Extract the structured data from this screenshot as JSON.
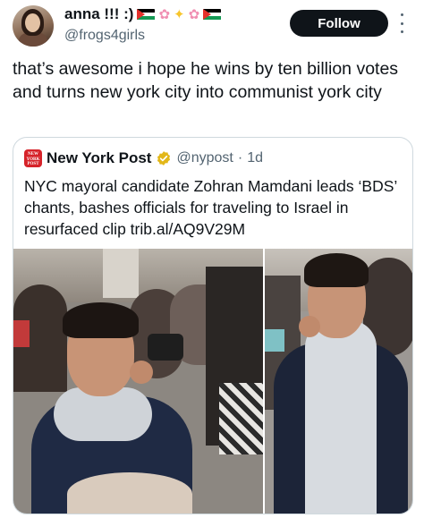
{
  "author": {
    "display_name": "anna !!! :)",
    "handle": "@frogs4girls",
    "name_emojis": [
      "flag",
      "blossom",
      "sparkle",
      "blossom",
      "flag"
    ]
  },
  "follow_button": {
    "label": "Follow"
  },
  "tweet": {
    "text": "that’s awesome i hope he wins by ten billion votes and turns new york city into communist york city"
  },
  "quoted_tweet": {
    "display_name": "New York Post",
    "logo_text": "NEW YORK POST",
    "handle": "@nypost",
    "separator": "·",
    "time": "1d",
    "text": "NYC mayoral candidate Zohran Mamdani leads ‘BDS’ chants, bashes officials for traveling to Israel in resurfaced clip trib.al/AQ9V29M"
  },
  "colors": {
    "text_primary": "#0f1419",
    "text_secondary": "#536471",
    "border": "#cfd9de",
    "follow_bg": "#0f1419",
    "verified_gold": "#e2b719",
    "nyp_red": "#d6232a"
  }
}
